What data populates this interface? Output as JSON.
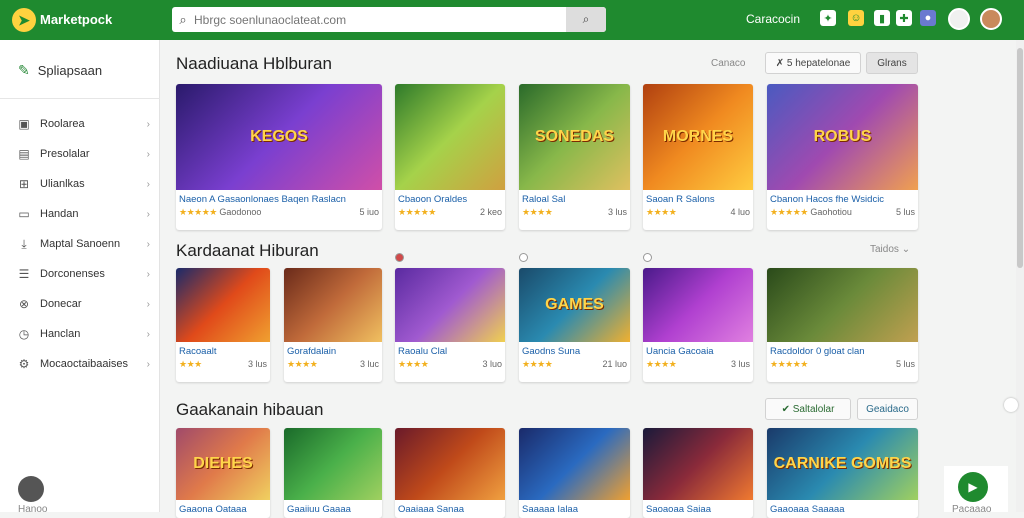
{
  "header": {
    "brand": "Marketpock",
    "search_placeholder": "Hbrgc soenlunaoclateat.com",
    "top_link": "Caracocin",
    "icons": [
      "puzzle-icon",
      "chat-icon",
      "bookmark-icon",
      "gift-icon",
      "bell-icon",
      "cat-avatar-icon"
    ]
  },
  "sidebar": {
    "heading": "Spliapsaan",
    "items": [
      {
        "label": "Roolarea",
        "icon": "box-icon"
      },
      {
        "label": "Presolalar",
        "icon": "image-icon"
      },
      {
        "label": "Ulianlkas",
        "icon": "grid-icon"
      },
      {
        "label": "Handan",
        "icon": "monitor-icon"
      },
      {
        "label": "Maptal Sanoenn",
        "icon": "download-icon"
      },
      {
        "label": "Dorconenses",
        "icon": "list-icon"
      },
      {
        "label": "Donecar",
        "icon": "settings-icon"
      },
      {
        "label": "Hanclan",
        "icon": "clock-icon"
      },
      {
        "label": "Mocaoctaibaaises",
        "icon": "gear-icon"
      }
    ]
  },
  "section1": {
    "title": "Naadiuana Hblburan",
    "link": "Canaco",
    "btn1": "✗ 5 hepatelonae",
    "btn2": "Glrans",
    "cards": [
      {
        "name": "Naeon A Gasaonlonaes Baqen Raslacn",
        "rating": "★★★★★",
        "sub": "Gaodonoo",
        "price": "5 iuo",
        "thumb_text": "KEGOS",
        "bg": "linear-gradient(135deg,#2a1a6b,#7a3fd0,#d04fa8)"
      },
      {
        "name": "Cbaoon Oraldes",
        "rating": "★★★★★",
        "sub": "",
        "price": "2 keo",
        "thumb_text": "",
        "bg": "linear-gradient(135deg,#2e7a2a,#a5d24a,#d0a040)"
      },
      {
        "name": "Raloal Sal",
        "rating": "★★★★",
        "sub": "",
        "price": "3 lus",
        "thumb_text": "SONEDAS",
        "bg": "linear-gradient(135deg,#2a6a2a,#88b84a,#e0c060)"
      },
      {
        "name": "Saoan R Salons",
        "rating": "★★★★",
        "sub": "",
        "price": "4 luo",
        "thumb_text": "MORNES",
        "bg": "linear-gradient(135deg,#b04010,#f08a20,#ffcc40)"
      },
      {
        "name": "Cbanon Hacos fhe Wsidcic",
        "rating": "★★★★★",
        "sub": "Gaohotiou",
        "price": "5 lus",
        "thumb_text": "ROBUS",
        "bg": "linear-gradient(135deg,#4a5ac0,#a04ab0,#f0a050)"
      }
    ]
  },
  "section2": {
    "title": "Kardaanat Hiburan",
    "sort": "Taidos",
    "cards": [
      {
        "name": "Racoaalt",
        "rating": "★★★",
        "sub": "",
        "price": "3 lus",
        "thumb_text": "",
        "bg": "linear-gradient(135deg,#1a2a6a,#e04a1a,#f0a030)"
      },
      {
        "name": "Gorafdalain",
        "rating": "★★★★",
        "sub": "",
        "price": "3 luc",
        "thumb_text": "",
        "bg": "linear-gradient(135deg,#6a2a1a,#c06a3a,#f0c060)"
      },
      {
        "name": "Raoalu Clal",
        "rating": "★★★★",
        "sub": "",
        "price": "3 luo",
        "thumb_text": "",
        "bg": "linear-gradient(135deg,#5a2aa0,#a05ad0,#f0d050)"
      },
      {
        "name": "Gaodns Suna",
        "rating": "★★★★",
        "sub": "",
        "price": "21 luo",
        "thumb_text": "GAMES",
        "bg": "linear-gradient(135deg,#1a4a6a,#2a8ab0,#f0b030)"
      },
      {
        "name": "Uancia Gacoaia",
        "rating": "★★★★",
        "sub": "",
        "price": "3 lus",
        "thumb_text": "",
        "bg": "linear-gradient(135deg,#4a1a8a,#b040d0,#e080e0)"
      },
      {
        "name": "Racdoldor 0 gloat clan",
        "rating": "★★★★★",
        "sub": "",
        "price": "5 lus",
        "thumb_text": "",
        "bg": "linear-gradient(135deg,#2a4a1a,#6a8a3a,#c0a050)"
      }
    ]
  },
  "section3": {
    "title": "Gaakanain hibauan",
    "btn1": "✔ Saltalolar",
    "btn2": "Geaidaco",
    "cards": [
      {
        "name": "Gaaona Oataaa",
        "thumb_text": "DIEHES",
        "bg": "linear-gradient(135deg,#a04a6a,#e07a4a,#f0d060)"
      },
      {
        "name": "Gaaiiuu Gaaaa",
        "thumb_text": "",
        "bg": "linear-gradient(135deg,#1a6a2a,#4ab04a,#a0d060)"
      },
      {
        "name": "Oaaiaaa Sanaa",
        "thumb_text": "",
        "bg": "linear-gradient(135deg,#6a1a2a,#c04a1a,#f0a040)"
      },
      {
        "name": "Saaaaa Ialaa",
        "thumb_text": "",
        "bg": "linear-gradient(135deg,#1a2a6a,#2a6ac0,#f0a030)"
      },
      {
        "name": "Saoaoaa Saiaa",
        "thumb_text": "",
        "bg": "linear-gradient(135deg,#1a1a3a,#8a2a3a,#f07a30)"
      },
      {
        "name": "Gaaoaaa Saaaaa",
        "thumb_text": "CARNIKE GOMBS",
        "bg": "linear-gradient(135deg,#1a3a6a,#2a8ab0,#a0d060)"
      }
    ]
  },
  "bottom": {
    "left_label": "Hanoo",
    "right_label": "Pacaaao"
  }
}
